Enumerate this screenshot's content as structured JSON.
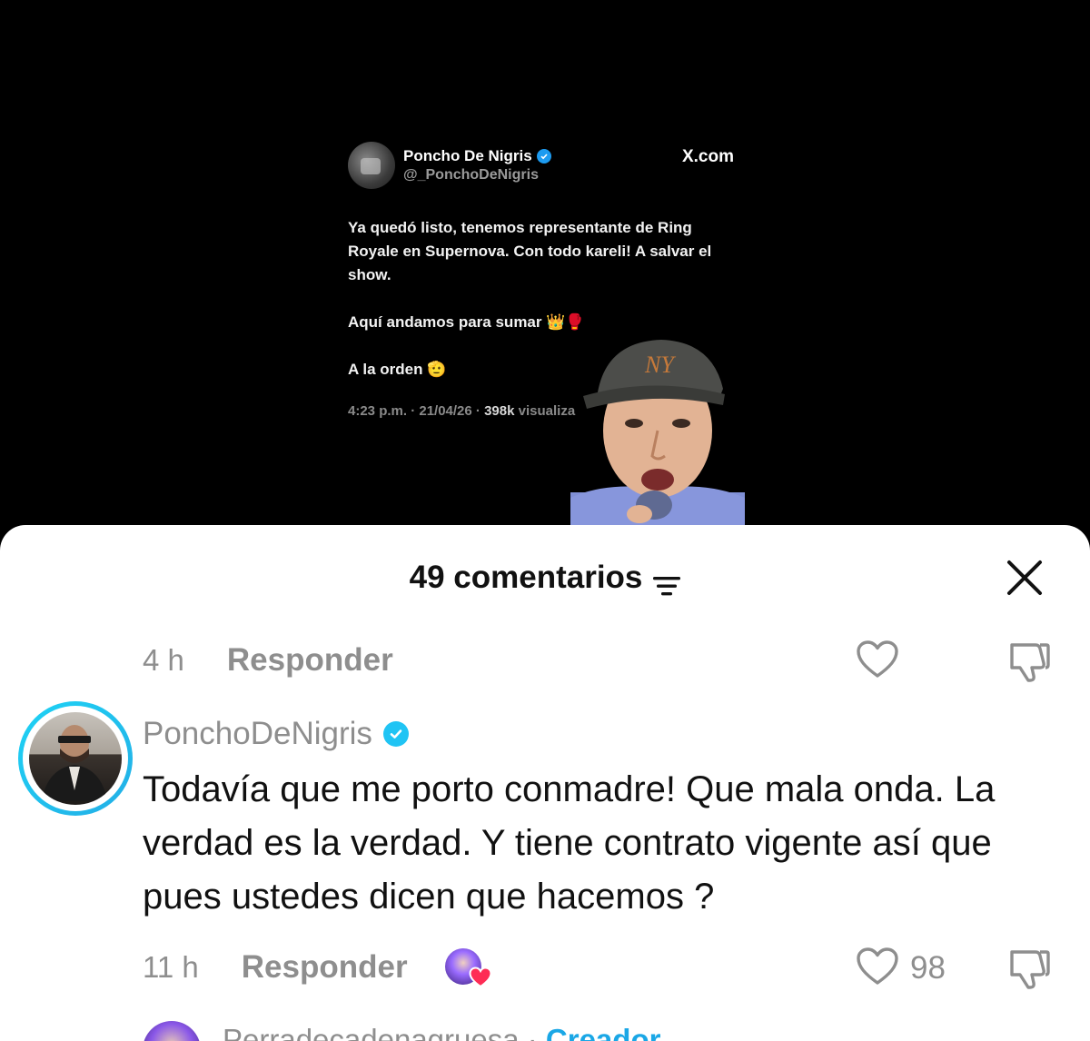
{
  "video": {
    "tweet": {
      "author_name": "Poncho De Nigris",
      "author_handle": "@_PonchoDeNigris",
      "source": "X.com",
      "paragraphs": [
        "Ya quedó listo, tenemos representante de Ring Royale en Supernova. Con todo kareli! A salvar el show.",
        "Aquí andamos para sumar 👑🥊",
        "A la orden 🫡"
      ],
      "meta_time": "4:23 p.m. · 21/04/26 · ",
      "meta_views": "398k",
      "meta_views_label": " visualiza"
    }
  },
  "comments_sheet": {
    "title": "49 comentarios",
    "close_icon": "close-icon",
    "filter_icon": "filter-icon",
    "previous_comment": {
      "time": "4 h",
      "reply_label": "Responder"
    },
    "comment": {
      "username": "PonchoDeNigris",
      "verified": true,
      "text": "Todavía que me porto conmadre! Que mala onda. La verdad es la verdad. Y tiene contrato vigente así que pues ustedes dicen que hacemos ?",
      "time": "11 h",
      "reply_label": "Responder",
      "likes": "98",
      "creator_liked": true
    },
    "next_comment": {
      "username": "Perradecadenagruesa",
      "separator": " · ",
      "badge": "Creador"
    }
  },
  "colors": {
    "accent_ring": "#20c4f4",
    "verified": "#20c4f4",
    "creator_badge": "#1aa7e6",
    "muted_text": "#8e8e8e",
    "heart_red": "#fe2c55"
  }
}
